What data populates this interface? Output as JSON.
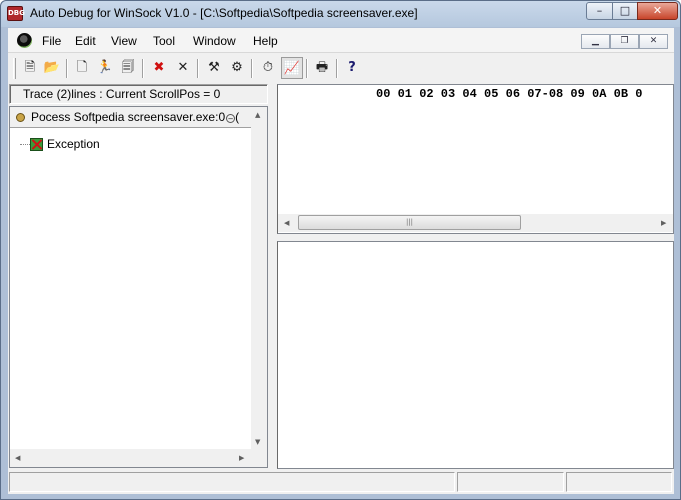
{
  "window": {
    "title": "Auto Debug for WinSock V1.0 - [C:\\Softpedia\\Softpedia screensaver.exe]",
    "app_icon_text": "DBG",
    "controls": {
      "minimize": "–",
      "maximize": "□",
      "close": "✕"
    }
  },
  "menubar": {
    "items": [
      {
        "label": "File"
      },
      {
        "label": "Edit"
      },
      {
        "label": "View"
      },
      {
        "label": "Tool"
      },
      {
        "label": "Window"
      },
      {
        "label": "Help"
      }
    ],
    "mdi_controls": {
      "minimize": "▁",
      "restore": "❐",
      "close": "✕"
    }
  },
  "toolbar": {
    "buttons": [
      {
        "name": "new-trace-icon",
        "glyph": "🗎"
      },
      {
        "name": "open-icon",
        "glyph": "📂"
      },
      {
        "name": "new-file-icon",
        "glyph": "🗋"
      },
      {
        "name": "run-icon",
        "glyph": "🏃"
      },
      {
        "name": "document-icon",
        "glyph": "🗐"
      },
      {
        "name": "delete-icon",
        "glyph": "✖"
      },
      {
        "name": "close-icon",
        "glyph": "✕"
      },
      {
        "name": "tools-icon",
        "glyph": "⚒"
      },
      {
        "name": "properties-icon",
        "glyph": "⚙"
      },
      {
        "name": "timer-icon",
        "glyph": "⏱"
      },
      {
        "name": "chart-icon",
        "glyph": "📈"
      },
      {
        "name": "print-icon",
        "glyph": "🖶"
      },
      {
        "name": "help-icon",
        "glyph": "?"
      }
    ]
  },
  "trace": {
    "header": "Trace (2)lines : Current ScrollPos = 0"
  },
  "tree": {
    "process_label": "Pocess Softpedia screensaver.exe:0",
    "process_suffix": "(",
    "nodes": [
      {
        "label": "Exception",
        "icon": "exception-icon"
      }
    ]
  },
  "hex": {
    "columns": "00 01 02 03 04 05 06 07-08 09 0A 0B 0"
  },
  "scroll": {
    "left": "◀",
    "right": "▶",
    "up": "▲",
    "down": "▼",
    "grip": "|||"
  }
}
